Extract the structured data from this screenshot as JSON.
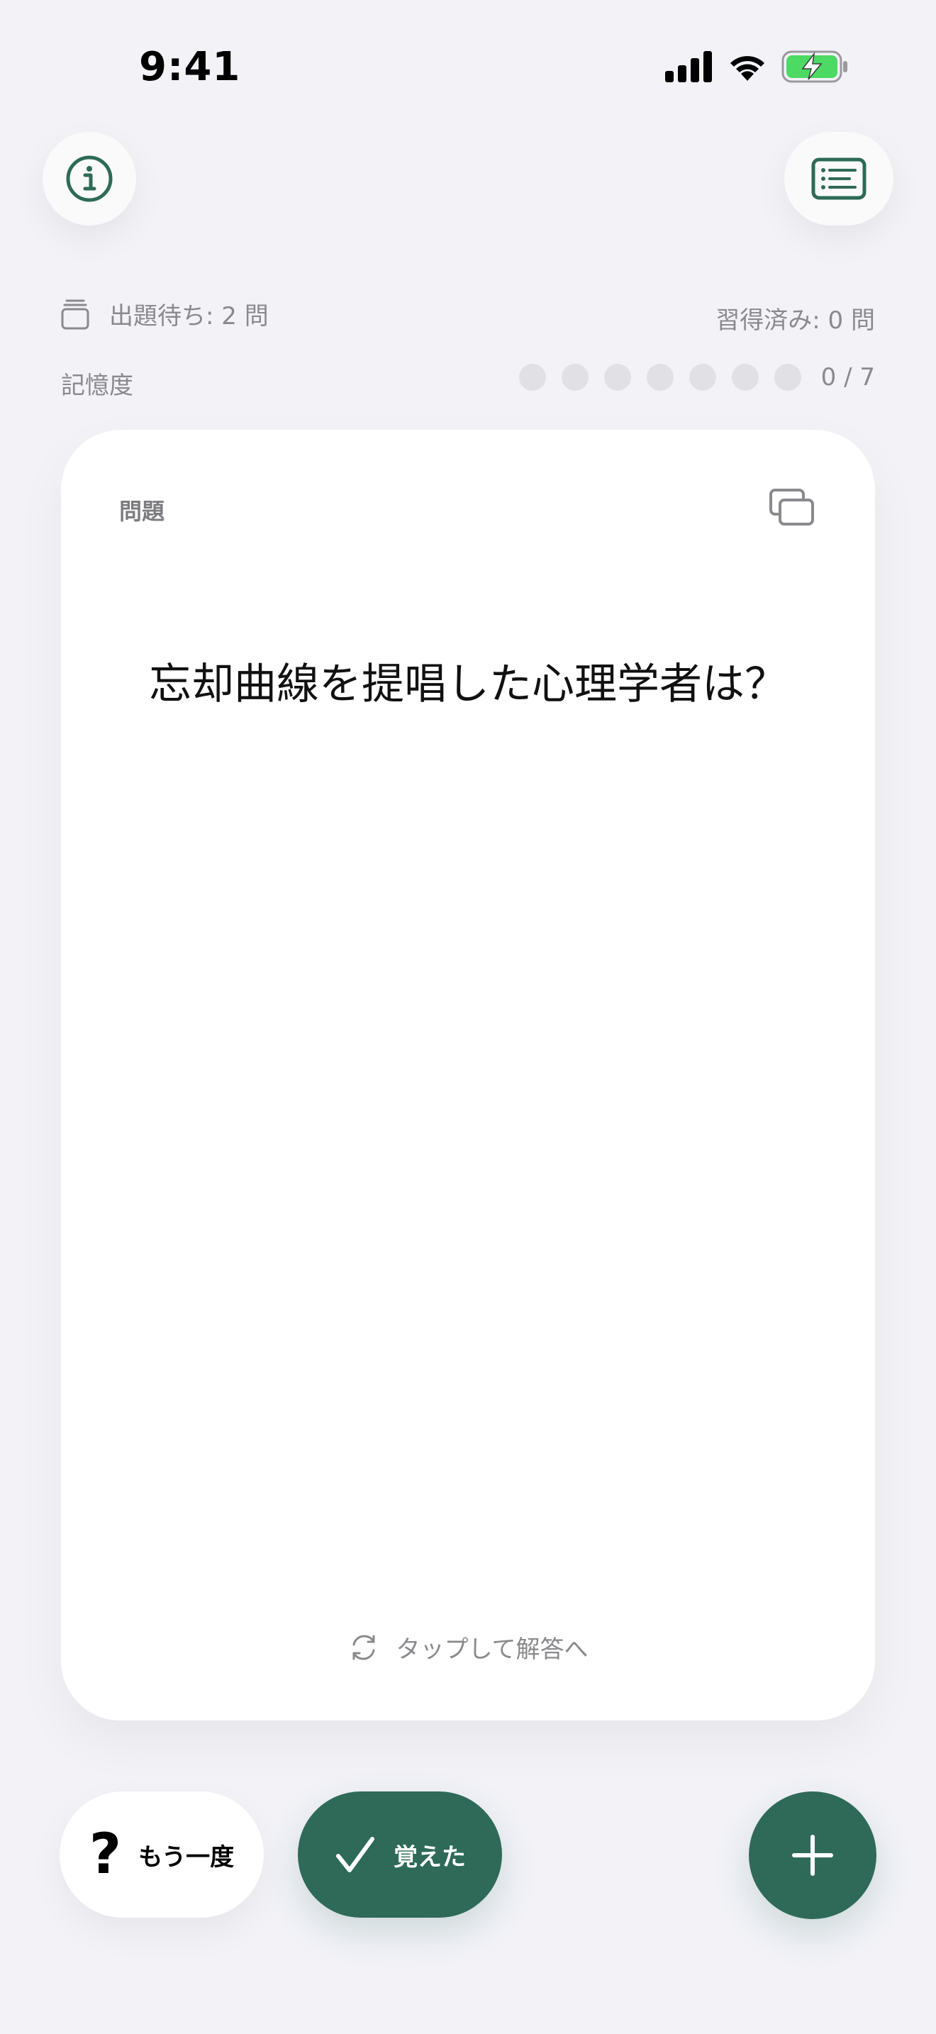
{
  "status_bar": {
    "time": "9:41",
    "icons": [
      "signal-icon",
      "wifi-icon",
      "battery-charging-icon"
    ]
  },
  "header": {
    "info_icon": "info-icon",
    "list_icon": "list-icon"
  },
  "stats": {
    "queue_label": "出題待ち: 2 問",
    "learned_label": "習得済み: 0 問",
    "memory_label": "記憶度",
    "memory_total": 7,
    "memory_filled": 0,
    "memory_count": "0 / 7"
  },
  "card": {
    "label": "問題",
    "question": "忘却曲線を提唱した心理学者は？",
    "tap_hint": "タップして解答へ"
  },
  "actions": {
    "again_label": "もう一度",
    "remember_label": "覚えた"
  },
  "colors": {
    "accent": "#2e6a57",
    "background": "#f2f2f7",
    "battery_green": "#4cd964"
  }
}
